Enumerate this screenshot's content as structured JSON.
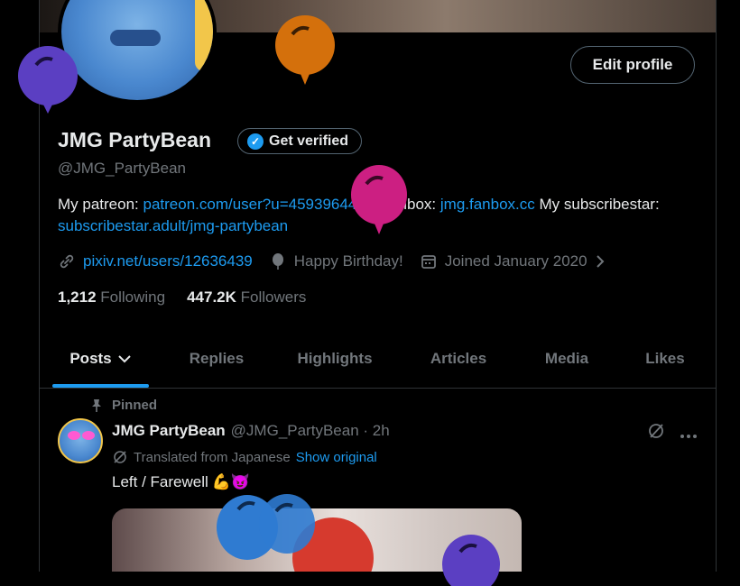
{
  "profile": {
    "name": "JMG PartyBean",
    "handle": "@JMG_PartyBean",
    "verified_label": "Get verified",
    "edit_label": "Edit profile",
    "bio": {
      "t1": "My patreon: ",
      "l1": "patreon.com/user?u=45939644",
      "t2": " My fanbox: ",
      "l2": "jmg.fanbox.cc",
      "t3": " My subscribestar: ",
      "l3": "subscribestar.adult/jmg-partybean"
    },
    "website": "pixiv.net/users/12636439",
    "birthday": "Happy Birthday!",
    "joined": "Joined January 2020",
    "following_count": "1,212",
    "following_label": "Following",
    "followers_count": "447.2K",
    "followers_label": "Followers"
  },
  "tabs": [
    {
      "label": "Posts"
    },
    {
      "label": "Replies"
    },
    {
      "label": "Highlights"
    },
    {
      "label": "Articles"
    },
    {
      "label": "Media"
    },
    {
      "label": "Likes"
    }
  ],
  "post": {
    "pinned_label": "Pinned",
    "author": "JMG PartyBean",
    "handle_time": "@JMG_PartyBean · 2h",
    "translated": "Translated from Japanese",
    "show_original": "Show original",
    "text": "Left / Farewell",
    "emoji": "💪😈"
  },
  "colors": {
    "accent": "#1d9bf0",
    "balloon_purple": "#5b3fc2",
    "balloon_orange": "#d4700c",
    "balloon_magenta": "#cc1f82",
    "balloon_blue": "#2f7bd1"
  }
}
